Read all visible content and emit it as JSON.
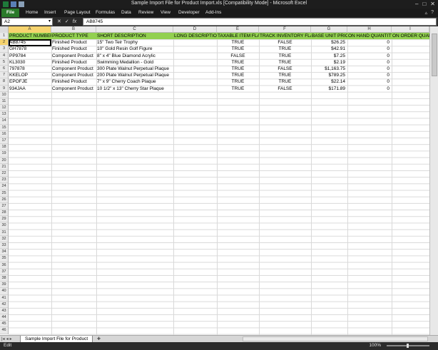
{
  "window": {
    "title": "Sample Import File for Product Import.xls  [Compatibility Mode]  -  Microsoft Excel",
    "controls": [
      "–",
      "□",
      "✕"
    ]
  },
  "ribbon": {
    "tabs": [
      "File",
      "Home",
      "Insert",
      "Page Layout",
      "Formulas",
      "Data",
      "Review",
      "View",
      "Developer",
      "Add-Ins"
    ]
  },
  "formula_bar": {
    "name_box": "A2",
    "fx": "fx",
    "value": "AB8745"
  },
  "columns": [
    "A",
    "B",
    "C",
    "D",
    "E",
    "F",
    "G",
    "H",
    "I"
  ],
  "header_row": [
    "PRODUCT NUMBER",
    "PRODUCT TYPE",
    "SHORT DESCRIPTION",
    "LONG DESCRIPTION",
    "TAXABLE ITEM FLAG",
    "TRACK INVENTORY FLAG",
    "BASE UNIT PRICE",
    "ON HAND QUANTITY",
    "ON ORDER QUANTI"
  ],
  "rows": [
    [
      "AB8745",
      "Finished Product",
      "15\" Two Teir Trophy",
      "",
      "TRUE",
      "FALSE",
      "$26.25",
      "0",
      ""
    ],
    [
      "GH7878",
      "Finished Product",
      "10\" Gold Resin Golf Figure",
      "",
      "TRUE",
      "TRUE",
      "$42.91",
      "0",
      ""
    ],
    [
      "PP9784",
      "Component Product",
      "8\" x 4\" Blue Diamond Acrylic",
      "",
      "FALSE",
      "TRUE",
      "$7.25",
      "0",
      ""
    ],
    [
      "KL3030",
      "Finished Product",
      "Swimming Medallion - Gold",
      "",
      "TRUE",
      "TRUE",
      "$2.19",
      "0",
      ""
    ],
    [
      "797878",
      "Component Product",
      "300 Plate Walnut Perpetual Plaque",
      "",
      "TRUE",
      "FALSE",
      "$1,163.75",
      "0",
      ""
    ],
    [
      "KKELOP",
      "Component Product",
      "200 Plate Walnut Perpetual Plaque",
      "",
      "TRUE",
      "TRUE",
      "$789.25",
      "0",
      ""
    ],
    [
      "EPOFJE",
      "Finished Product",
      "7\" x 9\" Cherry Coach Plaque",
      "",
      "TRUE",
      "TRUE",
      "$22.14",
      "0",
      ""
    ],
    [
      "934JAA",
      "Component Product",
      "10 1/2\" x 13\" Cherry Star Plaque",
      "",
      "TRUE",
      "FALSE",
      "$171.89",
      "0",
      ""
    ]
  ],
  "row_numbers": [
    "1",
    "2",
    "3",
    "4",
    "5",
    "6",
    "7",
    "8",
    "9",
    "10",
    "11",
    "12",
    "13",
    "14",
    "15",
    "16",
    "17",
    "18",
    "19",
    "20",
    "21",
    "22",
    "23",
    "24",
    "25",
    "26",
    "27",
    "28",
    "29",
    "30",
    "31",
    "32",
    "33",
    "34",
    "35",
    "36",
    "37",
    "38",
    "39",
    "40",
    "41",
    "42",
    "43",
    "44",
    "45",
    "46"
  ],
  "sheet_tab": "Sample Import File for Product",
  "status": {
    "mode": "Edit",
    "zoom": "100%"
  },
  "colors": {
    "header_fill": "#92d050",
    "file_tab": "#2a7a2a",
    "selected_header": "#f6d36e"
  }
}
